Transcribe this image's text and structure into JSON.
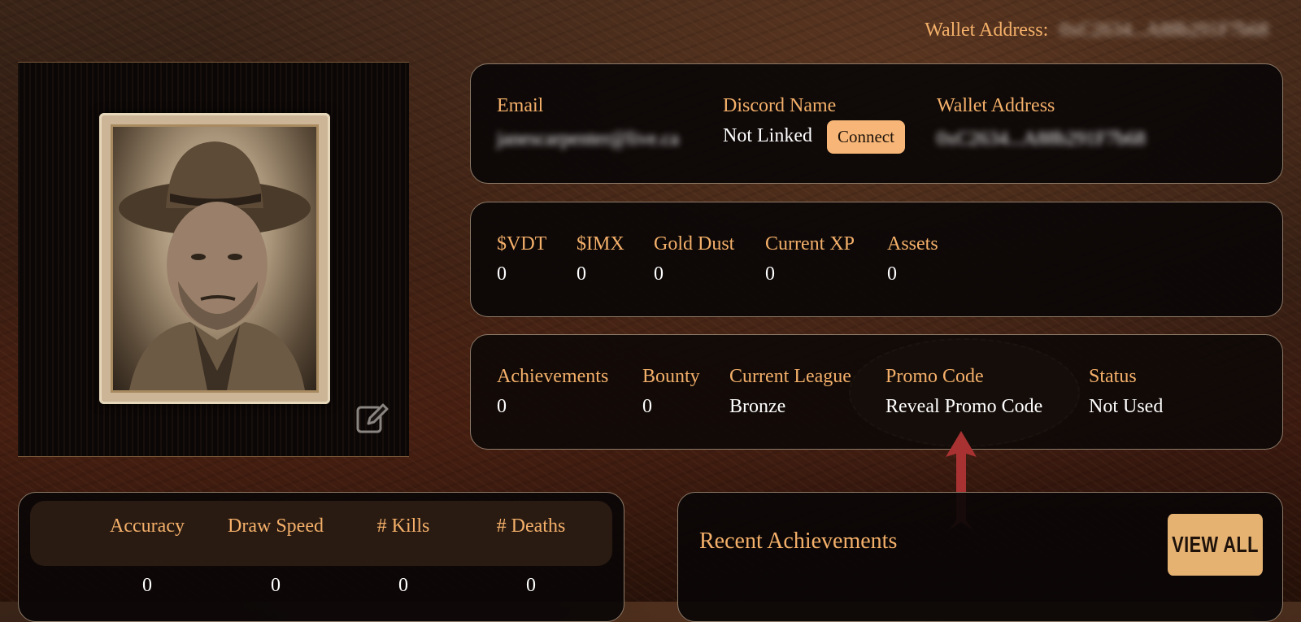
{
  "header": {
    "wallet_label": "Wallet Address:",
    "wallet_value": "0xC2634...A88b291F7b68"
  },
  "account_card": {
    "email": {
      "label": "Email",
      "value": "janescarpenter@live.ca"
    },
    "discord": {
      "label": "Discord Name",
      "value": "Not Linked",
      "connect_label": "Connect"
    },
    "wallet": {
      "label": "Wallet Address",
      "value": "0xC2634...A88b291F7b68"
    }
  },
  "currency_card": {
    "items": [
      {
        "label": "$VDT",
        "value": "0"
      },
      {
        "label": "$IMX",
        "value": "0"
      },
      {
        "label": "Gold Dust",
        "value": "0"
      },
      {
        "label": "Current XP",
        "value": "0"
      },
      {
        "label": "Assets",
        "value": "0"
      }
    ]
  },
  "progress_card": {
    "items": [
      {
        "label": "Achievements",
        "value": "0"
      },
      {
        "label": "Bounty",
        "value": "0"
      },
      {
        "label": "Current League",
        "value": "Bronze"
      },
      {
        "label": "Promo Code",
        "value": "Reveal Promo Code"
      },
      {
        "label": "Status",
        "value": "Not Used"
      }
    ]
  },
  "stats_card": {
    "columns": [
      {
        "label": "Accuracy",
        "value": "0"
      },
      {
        "label": "Draw Speed",
        "value": "0"
      },
      {
        "label": "# Kills",
        "value": "0"
      },
      {
        "label": "# Deaths",
        "value": "0"
      }
    ]
  },
  "recent": {
    "title": "Recent Achievements",
    "view_all_label": "VIEW ALL"
  },
  "icons": {
    "edit": "edit-pencil-icon",
    "arrow": "up-arrow-icon"
  },
  "colors": {
    "accent": "#f4b06a",
    "button": "#f7b677",
    "card_bg": "#0a0706",
    "arrow": "#a83232"
  }
}
